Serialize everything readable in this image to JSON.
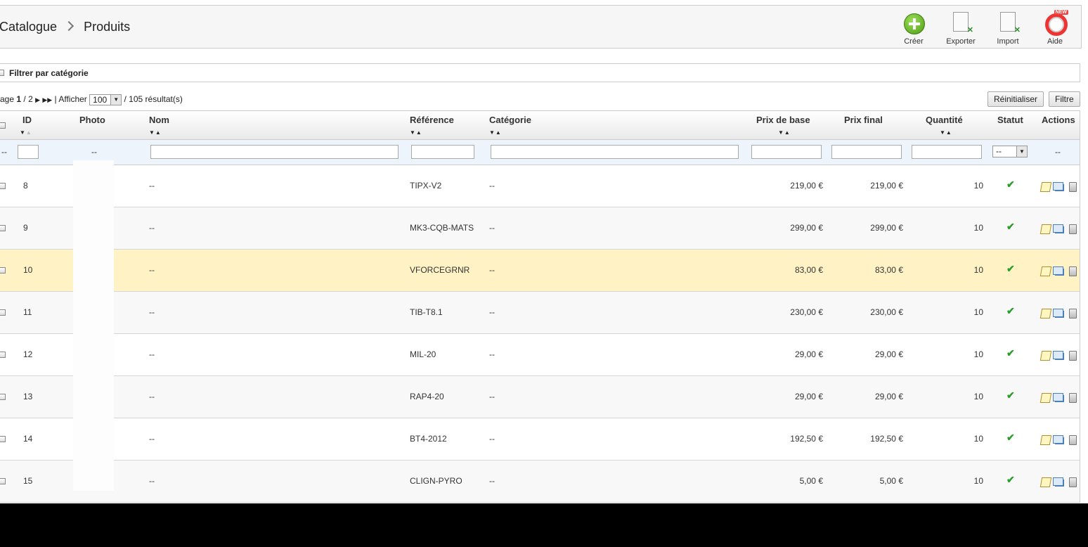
{
  "breadcrumb": {
    "parent": "Catalogue",
    "current": "Produits"
  },
  "toolbar": {
    "create_label": "Créer",
    "export_label": "Exporter",
    "import_label": "Import",
    "help_label": "Aide",
    "help_badge": "NEW"
  },
  "filter_by_category": {
    "label": "Filtrer par catégorie",
    "checked": false
  },
  "pagination": {
    "page_prefix": "age",
    "current_page": "1",
    "total_pages": "/ 2",
    "show_label": "| Afficher",
    "per_page": "100",
    "results": "/ 105 résultat(s)"
  },
  "buttons": {
    "reset_label": "Réinitialiser",
    "filter_label": "Filtre"
  },
  "table": {
    "headers": {
      "id": "ID",
      "photo": "Photo",
      "name": "Nom",
      "reference": "Référence",
      "category": "Catégorie",
      "base_price": "Prix de base",
      "final_price": "Prix final",
      "quantity": "Quantité",
      "status": "Statut",
      "actions": "Actions"
    },
    "filter_row": {
      "checkbox_dash": "--",
      "photo_dash": "--",
      "status_value": "--",
      "actions_dash": "--"
    },
    "rows": [
      {
        "id": "8",
        "name": "--",
        "reference": "TIPX-V2",
        "category": "--",
        "base_price": "219,00 €",
        "final_price": "219,00 €",
        "quantity": "10",
        "status": "active"
      },
      {
        "id": "9",
        "name": "--",
        "reference": "MK3-CQB-MATS",
        "category": "--",
        "base_price": "299,00 €",
        "final_price": "299,00 €",
        "quantity": "10",
        "status": "active"
      },
      {
        "id": "10",
        "name": "--",
        "reference": "VFORCEGRNR",
        "category": "--",
        "base_price": "83,00 €",
        "final_price": "83,00 €",
        "quantity": "10",
        "status": "active"
      },
      {
        "id": "11",
        "name": "--",
        "reference": "TIB-T8.1",
        "category": "--",
        "base_price": "230,00 €",
        "final_price": "230,00 €",
        "quantity": "10",
        "status": "active"
      },
      {
        "id": "12",
        "name": "--",
        "reference": "MIL-20",
        "category": "--",
        "base_price": "29,00 €",
        "final_price": "29,00 €",
        "quantity": "10",
        "status": "active"
      },
      {
        "id": "13",
        "name": "--",
        "reference": "RAP4-20",
        "category": "--",
        "base_price": "29,00 €",
        "final_price": "29,00 €",
        "quantity": "10",
        "status": "active"
      },
      {
        "id": "14",
        "name": "--",
        "reference": "BT4-2012",
        "category": "--",
        "base_price": "192,50 €",
        "final_price": "192,50 €",
        "quantity": "10",
        "status": "active"
      },
      {
        "id": "15",
        "name": "--",
        "reference": "CLIGN-PYRO",
        "category": "--",
        "base_price": "5,00 €",
        "final_price": "5,00 €",
        "quantity": "10",
        "status": "active"
      }
    ]
  },
  "colors": {
    "highlight_row": "#fff3c5",
    "status_ok": "#2a9d2a"
  }
}
